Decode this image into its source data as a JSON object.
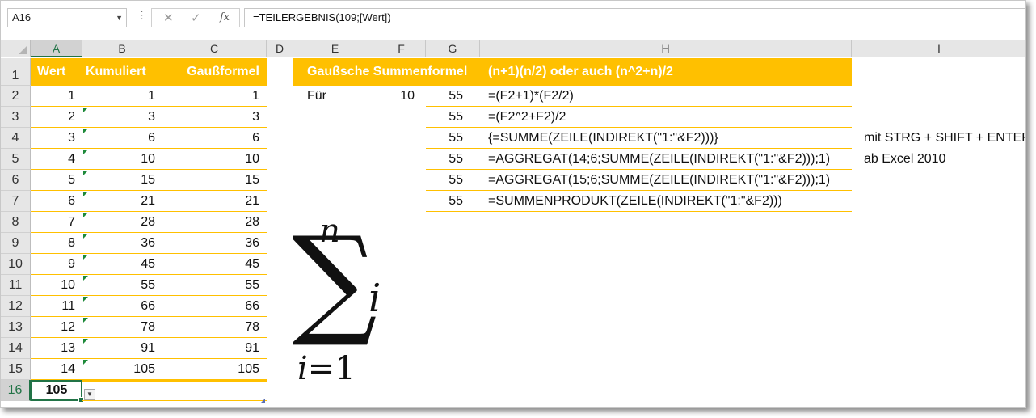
{
  "namebox": "A16",
  "formula_bar": {
    "fx": "fx",
    "formula": "=TEILERGEBNIS(109;[Wert])"
  },
  "columns": [
    "A",
    "B",
    "C",
    "D",
    "E",
    "F",
    "G",
    "H",
    "I"
  ],
  "rows": [
    "1",
    "2",
    "3",
    "4",
    "5",
    "6",
    "7",
    "8",
    "9",
    "10",
    "11",
    "12",
    "13",
    "14",
    "15",
    "16"
  ],
  "table_headers": {
    "a": "Wert",
    "b": "Kumuliert",
    "c": "Gaußformel"
  },
  "table_rows": [
    [
      "1",
      "1",
      "1"
    ],
    [
      "2",
      "3",
      "3"
    ],
    [
      "3",
      "6",
      "6"
    ],
    [
      "4",
      "10",
      "10"
    ],
    [
      "5",
      "15",
      "15"
    ],
    [
      "6",
      "21",
      "21"
    ],
    [
      "7",
      "28",
      "28"
    ],
    [
      "8",
      "36",
      "36"
    ],
    [
      "9",
      "45",
      "45"
    ],
    [
      "10",
      "55",
      "55"
    ],
    [
      "11",
      "66",
      "66"
    ],
    [
      "12",
      "78",
      "78"
    ],
    [
      "13",
      "91",
      "91"
    ],
    [
      "14",
      "105",
      "105"
    ]
  ],
  "total": "105",
  "right_headers": {
    "e": "Gaußsche Summenformel",
    "h": "(n+1)(n/2) oder auch (n^2+n)/2"
  },
  "fuer_label": "Für",
  "fuer_value": "10",
  "formula_rows": [
    {
      "g": "55",
      "h": "=(F2+1)*(F2/2)",
      "i": ""
    },
    {
      "g": "55",
      "h": "=(F2^2+F2)/2",
      "i": ""
    },
    {
      "g": "55",
      "h": "{=SUMME(ZEILE(INDIREKT(\"1:\"&F2)))}",
      "i": "mit STRG + SHIFT + ENTER"
    },
    {
      "g": "55",
      "h": "=AGGREGAT(14;6;SUMME(ZEILE(INDIREKT(\"1:\"&F2)));1)",
      "i": "ab Excel 2010"
    },
    {
      "g": "55",
      "h": "=AGGREGAT(15;6;SUMME(ZEILE(INDIREKT(\"1:\"&F2)));1)",
      "i": ""
    },
    {
      "g": "55",
      "h": "=SUMMENPRODUKT(ZEILE(INDIREKT(\"1:\"&F2)))",
      "i": ""
    }
  ],
  "sigma": {
    "upper": "n",
    "symbol": "∑",
    "term": "i",
    "lower_var": "i",
    "lower_rest": "=1"
  },
  "colors": {
    "header_fill": "#ffc000",
    "accent_green": "#217346"
  }
}
